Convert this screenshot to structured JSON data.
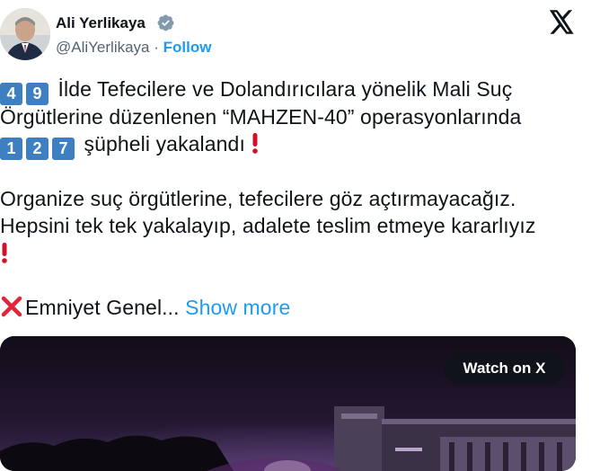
{
  "author": {
    "display_name": "Ali Yerlikaya",
    "handle": "@AliYerlikaya",
    "separator": "·",
    "follow_label": "Follow",
    "verified_icon": "verified-badge-icon"
  },
  "brand_icon": "x-logo-icon",
  "tweet": {
    "line1_digits": [
      "4",
      "9"
    ],
    "line1_text": "İlde Tefecilere ve Dolandırıcılara yönelik Mali Suç",
    "line2_text": "Örgütlerine düzenlenen “MAHZEN-40” operasyonlarında",
    "line3_digits": [
      "1",
      "2",
      "7"
    ],
    "line3_text": "şüpheli yakalandı",
    "line4_text": "Organize suç örgütlerine, tefecilere göz açtırmayacağız.",
    "line5_text": "Hepsini tek tek yakalayıp, adalete teslim etmeye kararlıyız",
    "line6_text": "Emniyet Genel...",
    "show_more": "Show more"
  },
  "media": {
    "watch_label": "Watch on X"
  },
  "colors": {
    "link": "#1d9bf0",
    "text": "#0f1419",
    "muted": "#536471",
    "keycap": "#3e7fc1",
    "exclamation": "#d0112b"
  }
}
